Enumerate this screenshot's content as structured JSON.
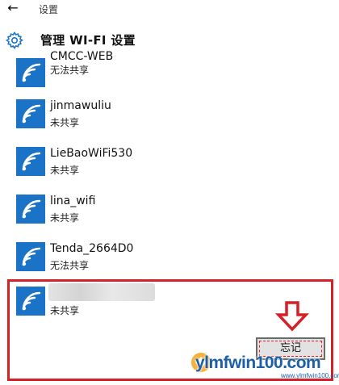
{
  "titlebar": {
    "back_icon": "back-arrow-icon",
    "title": "设置"
  },
  "header": {
    "icon": "gear-icon",
    "title": "管理 WI-FI 设置"
  },
  "networks": [
    {
      "name": "CMCC-WEB",
      "status": "无法共享"
    },
    {
      "name": "jinmawuliu",
      "status": "未共享"
    },
    {
      "name": "LieBaoWiFi530",
      "status": "未共享"
    },
    {
      "name": "lina_wifi",
      "status": "未共享"
    },
    {
      "name": "Tenda_2664D0",
      "status": "无法共享"
    }
  ],
  "selected": {
    "name": "",
    "status": "未共享"
  },
  "forget_button": {
    "label": "忘记"
  },
  "watermark": {
    "text": "ylmfwin100.com",
    "sub": "www.ylmfwin100.com"
  },
  "colors": {
    "tile": "#1a73c6",
    "highlight": "#d71f28",
    "brand": "#1a5fa8"
  }
}
